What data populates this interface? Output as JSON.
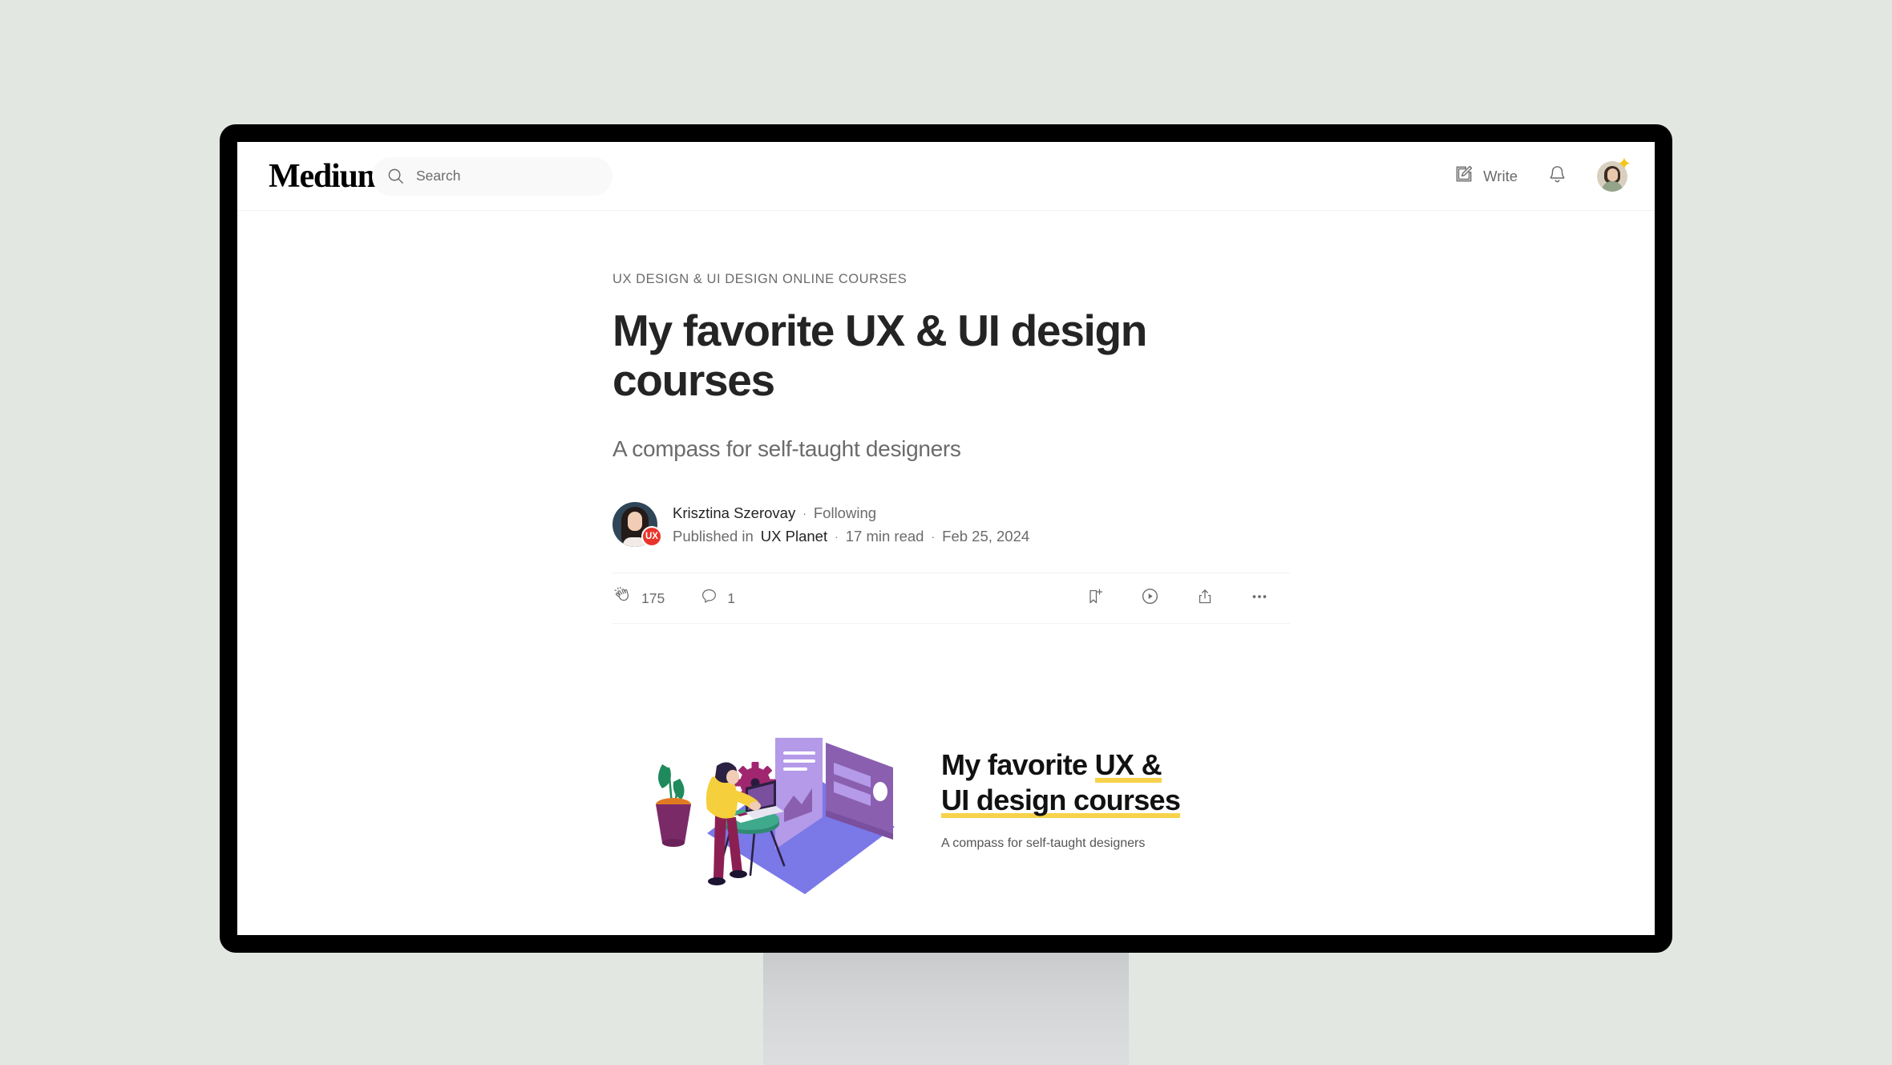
{
  "window": {
    "background_color": "#e2e7e1",
    "bezel_color": "#000000",
    "stand_color": "#d3d5d7"
  },
  "header": {
    "logo": "Medium",
    "search": {
      "placeholder": "Search",
      "value": "",
      "icon": "search-icon"
    },
    "write": {
      "label": "Write",
      "icon": "write-pencil-icon"
    },
    "notifications": {
      "icon": "bell-icon"
    },
    "avatar": {
      "name": "user-avatar",
      "badge_icon": "star-badge-icon",
      "badge_color": "#f5c518"
    }
  },
  "article": {
    "kicker": "UX DESIGN & UI DESIGN ONLINE COURSES",
    "title": "My favorite UX & UI design courses",
    "subtitle": "A compass for self-taught designers",
    "byline": {
      "author": "Krisztina Szerovay",
      "separator": "·",
      "follow_state": "Following",
      "published_prefix": "Published in",
      "publication": "UX Planet",
      "publication_badge": "UX",
      "publication_badge_color": "#e8352b",
      "read_time": "17 min read",
      "date": "Feb 25, 2024"
    },
    "actions": {
      "clap": {
        "icon": "clap-icon",
        "count": "175"
      },
      "comment": {
        "icon": "comment-icon",
        "count": "1"
      },
      "bookmark": {
        "icon": "bookmark-add-icon"
      },
      "listen": {
        "icon": "play-circle-icon"
      },
      "share": {
        "icon": "share-icon"
      },
      "more": {
        "icon": "more-horizontal-icon"
      }
    },
    "hero": {
      "title_line1_plain": "My favorite ",
      "title_line1_highlight": "UX &",
      "title_line2_highlight": "UI design courses",
      "subtitle": "A compass for self-taught designers",
      "highlight_color": "#f7d24a",
      "illustration": {
        "name": "isometric-desk-illustration",
        "base_color": "#7b78e8",
        "panel_light_color": "#b49ae8",
        "panel_dark_color": "#8a5fb0",
        "gear_color": "#a0276f",
        "shirt_color": "#f5cf3c",
        "pants_color": "#8c1f52",
        "plant_leaf_color": "#1f8a5c",
        "plant_pot_color": "#7b2a68",
        "plant_soil_color": "#e07a22"
      }
    }
  }
}
